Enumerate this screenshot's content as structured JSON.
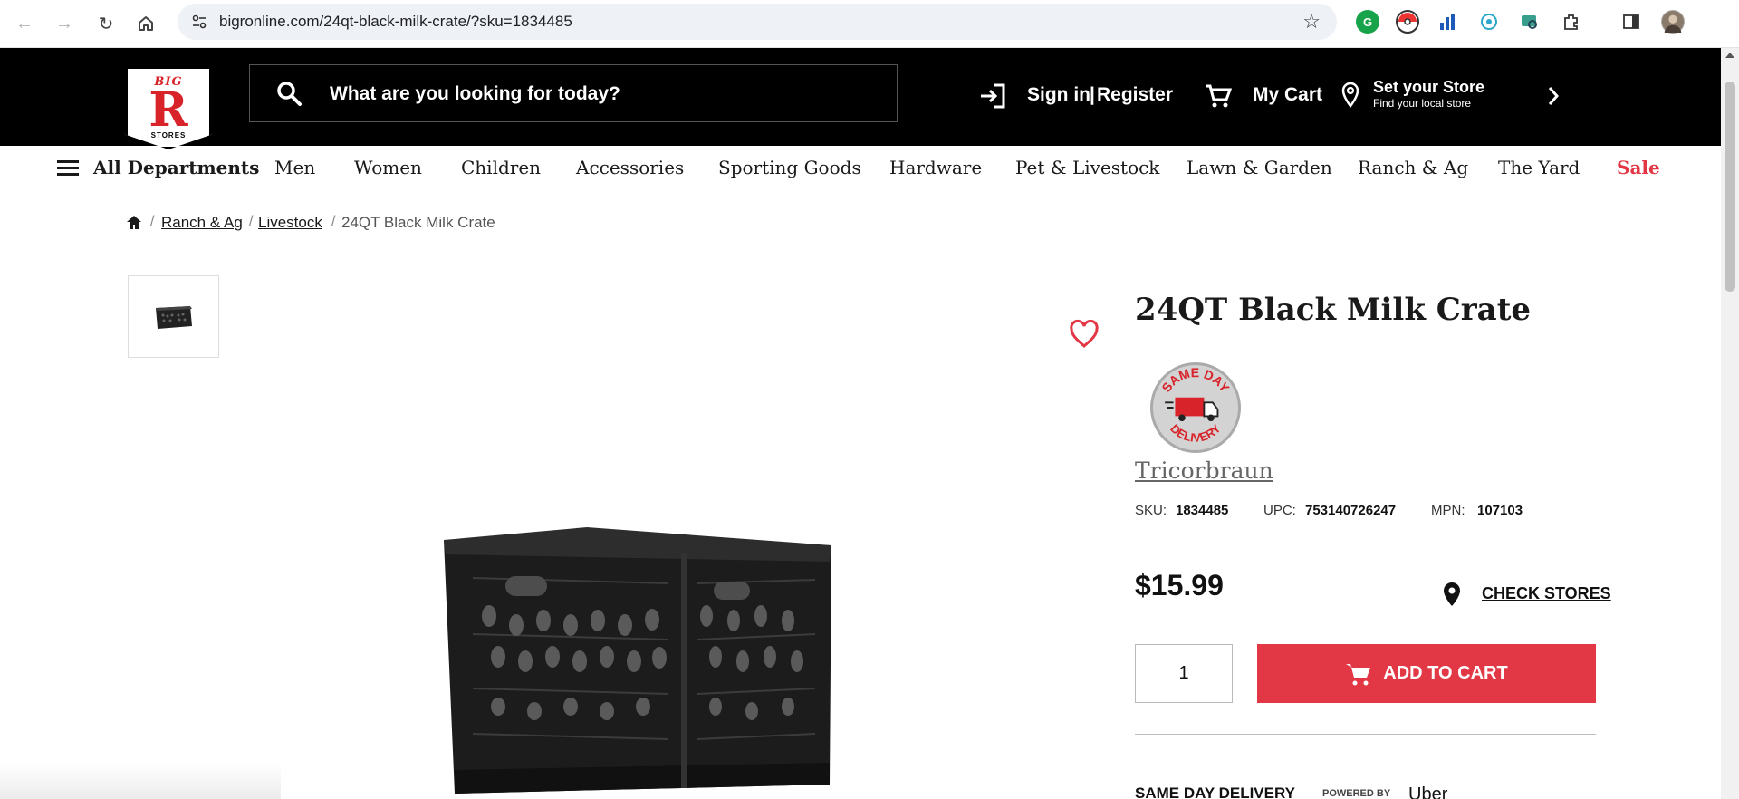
{
  "browser": {
    "url": "bigronline.com/24qt-black-milk-crate/?sku=1834485"
  },
  "header": {
    "logo": {
      "big": "BIG",
      "r": "R",
      "stores": "STORES"
    },
    "search_placeholder": "What are you looking for today?",
    "sign_in": "Sign in",
    "register": "Register",
    "cart": "My Cart",
    "store_title": "Set your Store",
    "store_sub": "Find your local store"
  },
  "nav": {
    "all_departments": "All Departments",
    "items": [
      "Men",
      "Women",
      "Children",
      "Accessories",
      "Sporting Goods",
      "Hardware",
      "Pet & Livestock",
      "Lawn & Garden",
      "Ranch & Ag",
      "The Yard",
      "Sale"
    ]
  },
  "breadcrumb": {
    "items": [
      "Ranch & Ag",
      "Livestock",
      "24QT Black Milk Crate"
    ]
  },
  "product": {
    "title": "24QT Black Milk Crate",
    "badge_text": [
      "SAME DAY",
      "DELIVERY"
    ],
    "brand": "Tricorbraun",
    "sku_label": "SKU:",
    "sku": "1834485",
    "upc_label": "UPC:",
    "upc": "753140726247",
    "mpn_label": "MPN:",
    "mpn": "107103",
    "price": "$15.99",
    "check_stores": "CHECK STORES",
    "quantity": "1",
    "add_to_cart": "ADD TO CART",
    "same_day_delivery": "SAME DAY DELIVERY",
    "powered_by": "POWERED BY",
    "uber": "Uber"
  },
  "colors": {
    "brand_red": "#e23745",
    "header_bg": "#000000"
  }
}
